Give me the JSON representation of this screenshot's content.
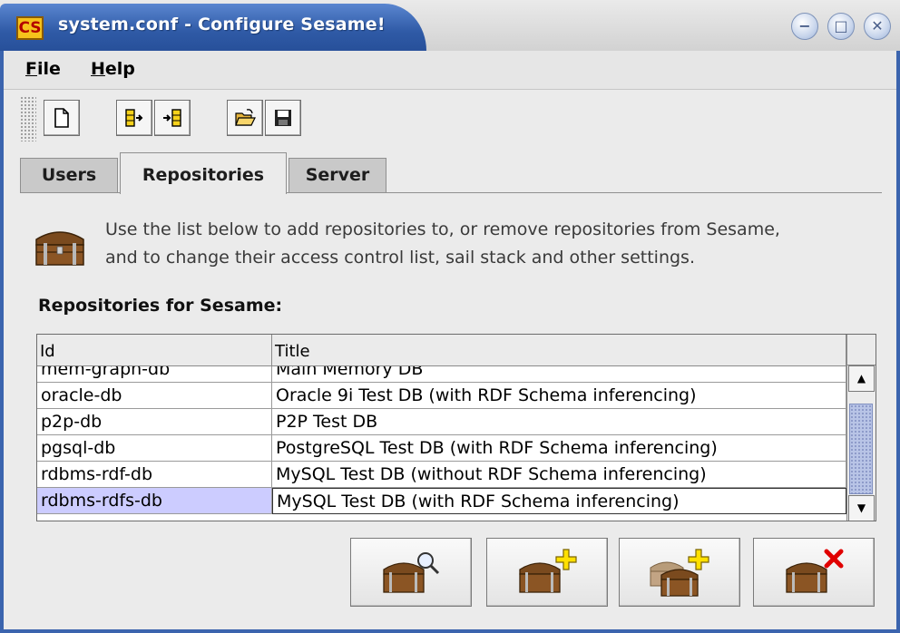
{
  "window": {
    "title": "system.conf - Configure Sesame!",
    "app_icon_text": "CS",
    "controls": {
      "minimize": "−",
      "maximize": "□",
      "close": "✕"
    }
  },
  "menu": {
    "file_first": "F",
    "file_rest": "ile",
    "help_first": "H",
    "help_rest": "elp"
  },
  "toolbar": {
    "icons": [
      "new-file-icon",
      "export-icon",
      "import-icon",
      "open-folder-icon",
      "save-icon"
    ]
  },
  "tabs": [
    {
      "label": "Users",
      "active": false
    },
    {
      "label": "Repositories",
      "active": true
    },
    {
      "label": "Server",
      "active": false
    }
  ],
  "content": {
    "description_line1": "Use the list below to add repositories to, or remove repositories from Sesame,",
    "description_line2": "and to change their access control list, sail stack and other settings.",
    "section_title": "Repositories for Sesame:"
  },
  "table": {
    "headers": [
      "Id",
      "Title"
    ],
    "rows": [
      {
        "id": "mem-graph-db",
        "title": "Main Memory DB"
      },
      {
        "id": "oracle-db",
        "title": "Oracle 9i Test DB (with RDF Schema inferencing)"
      },
      {
        "id": "p2p-db",
        "title": "P2P Test DB"
      },
      {
        "id": "pgsql-db",
        "title": "PostgreSQL Test DB (with RDF Schema inferencing)"
      },
      {
        "id": "rdbms-rdf-db",
        "title": "MySQL Test DB (without RDF Schema inferencing)"
      },
      {
        "id": "rdbms-rdfs-db",
        "title": "MySQL Test DB (with RDF Schema inferencing)",
        "selected": true
      }
    ],
    "scroll_up": "▲",
    "scroll_down": "▼"
  },
  "buttons": [
    "inspect-repository-icon",
    "add-repository-icon",
    "add-multiple-repositories-icon",
    "remove-repository-icon"
  ],
  "colors": {
    "titlebar": "#2f5aa6",
    "selection": "#ccccff",
    "window_bg": "#ebebeb"
  }
}
